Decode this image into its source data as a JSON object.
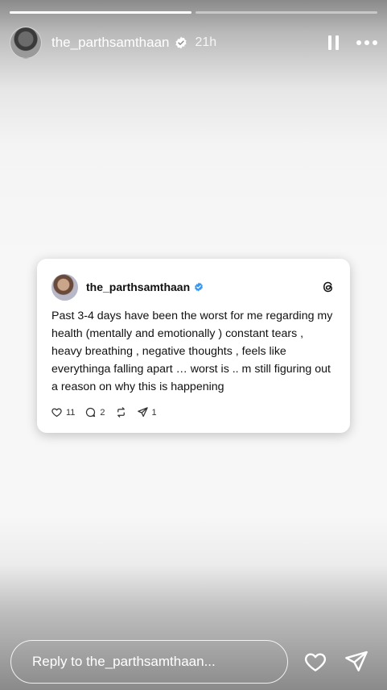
{
  "story": {
    "progress": [
      1.0,
      0.0
    ],
    "username": "the_parthsamthaan",
    "time": "21h",
    "colors": {
      "verified": "#3897f0",
      "overlay_text": "#ffffff"
    }
  },
  "card": {
    "username": "the_parthsamthaan",
    "text": "Past 3-4 days have been the worst for me regarding my health (mentally and emotionally ) constant tears , heavy breathing , negative thoughts , feels like everythinga falling apart … worst is .. m still figuring out a reason on why this is happening",
    "likes": "11",
    "comments": "2",
    "shares": "1"
  },
  "reply": {
    "placeholder": "Reply to the_parthsamthaan..."
  }
}
